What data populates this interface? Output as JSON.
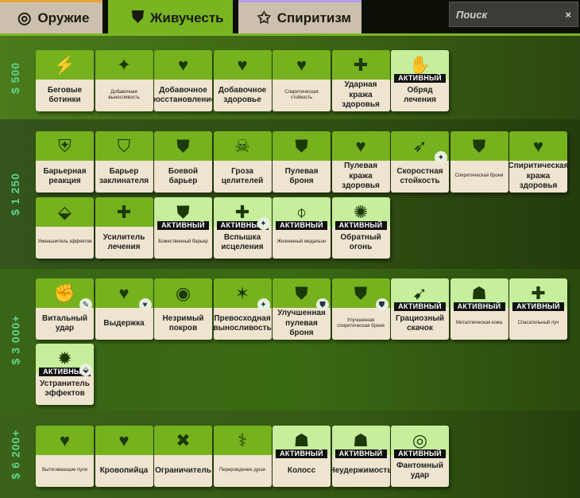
{
  "tabs": [
    {
      "label": "Оружие",
      "icon": "weapon-icon",
      "glyph": "◎"
    },
    {
      "label": "Живучесть",
      "icon": "vitality-shield-icon",
      "glyph": "⛊"
    },
    {
      "label": "Спиритизм",
      "icon": "spirit-star-icon",
      "glyph": "✩"
    }
  ],
  "search": {
    "placeholder": "Поиск",
    "clear": "×"
  },
  "colors": {
    "card_top": "#76b21d",
    "card_top_active": "#c6ee9c",
    "card_bottom": "#efe4cf",
    "tier_label": "#5fd38f"
  },
  "active_label": "АКТИВНЫЙ",
  "tiers": [
    {
      "label": "$ 500",
      "items": [
        {
          "name": "Беговые ботинки",
          "g": "⚡"
        },
        {
          "name": "Добавочная выносливость",
          "g": "✦",
          "small": true
        },
        {
          "name": "Добавочное восстановление",
          "g": "♥"
        },
        {
          "name": "Добавочное здоровье",
          "g": "♥"
        },
        {
          "name": "Спиритическая стойкость",
          "g": "♥",
          "small": true
        },
        {
          "name": "Ударная кража здоровья",
          "g": "✚"
        },
        {
          "name": "Обряд лечения",
          "g": "✋",
          "active": true
        }
      ]
    },
    {
      "label": "$ 1 250",
      "items": [
        {
          "name": "Барьерная реакция",
          "g": "⛨"
        },
        {
          "name": "Барьер заклинателя",
          "g": "⛉"
        },
        {
          "name": "Боевой барьер",
          "g": "⛊"
        },
        {
          "name": "Гроза целителей",
          "g": "☠"
        },
        {
          "name": "Пулевая броня",
          "g": "⛊"
        },
        {
          "name": "Пулевая кража здоровья",
          "g": "♥"
        },
        {
          "name": "Скоростная стойкость",
          "g": "➶",
          "sub": "✦"
        },
        {
          "name": "Спиритическая броня",
          "g": "⛊",
          "small": true
        },
        {
          "name": "Спиритическая кража здоровья",
          "g": "♥"
        },
        {
          "name": "Уменьшитель эффектов",
          "g": "⬙",
          "small": true
        },
        {
          "name": "Усилитель лечения",
          "g": "✚"
        },
        {
          "name": "Божественный барьер",
          "g": "⛊",
          "active": true,
          "small": true
        },
        {
          "name": "Вспышка исцеления",
          "g": "✚",
          "active": true,
          "sub": "✦"
        },
        {
          "name": "Жизненный медальон",
          "g": "⌽",
          "active": true,
          "small": true
        },
        {
          "name": "Обратный огонь",
          "g": "✺",
          "active": true
        }
      ]
    },
    {
      "label": "$ 3 000+",
      "items": [
        {
          "name": "Витальный удар",
          "g": "✊",
          "sub": "✎"
        },
        {
          "name": "Выдержка",
          "g": "♥",
          "sub": "♥"
        },
        {
          "name": "Незримый покров",
          "g": "◉"
        },
        {
          "name": "Превосходная выносливость",
          "g": "✶",
          "sub": "✦"
        },
        {
          "name": "Улучшенная пулевая броня",
          "g": "⛊",
          "sub": "⛊"
        },
        {
          "name": "Улучшенная спиритическая броня",
          "g": "⛊",
          "sub": "⛊",
          "small": true
        },
        {
          "name": "Грациозный скачок",
          "g": "➹",
          "active": true
        },
        {
          "name": "Металлическая кожа",
          "g": "☗",
          "active": true,
          "small": true
        },
        {
          "name": "Спасательный луч",
          "g": "✚",
          "active": true,
          "small": true
        },
        {
          "name": "Устранитель эффектов",
          "g": "✹",
          "active": true,
          "sub": "⬙"
        }
      ]
    },
    {
      "label": "$ 6 200+",
      "items": [
        {
          "name": "Вытягивающие пули",
          "g": "♥",
          "small": true
        },
        {
          "name": "Кровопийца",
          "g": "♥"
        },
        {
          "name": "Ограничитель",
          "g": "✖"
        },
        {
          "name": "Перерождение души",
          "g": "⚕",
          "small": true
        },
        {
          "name": "Колосс",
          "g": "☗",
          "active": true
        },
        {
          "name": "Неудержимость",
          "g": "☗",
          "active": true
        },
        {
          "name": "Фантомный удар",
          "g": "◎",
          "active": true
        }
      ]
    }
  ]
}
